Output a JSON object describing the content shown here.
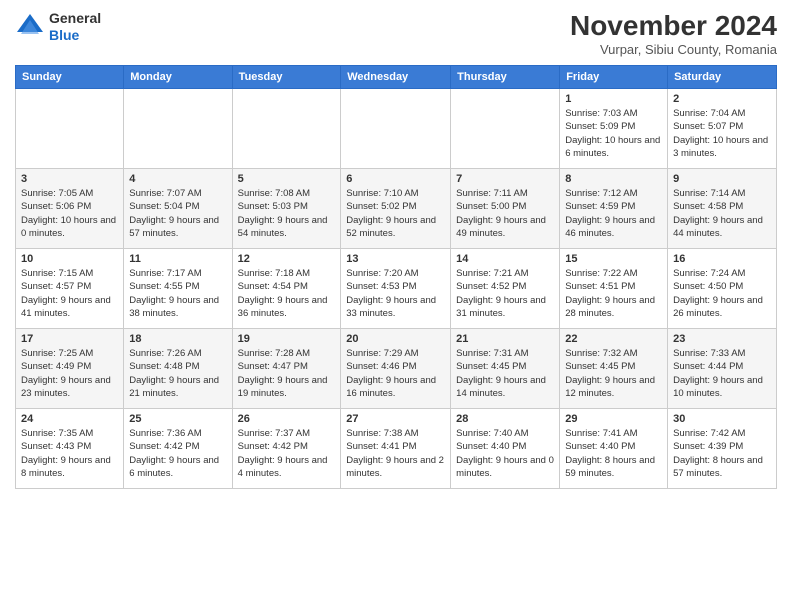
{
  "header": {
    "logo_line1": "General",
    "logo_line2": "Blue",
    "month_title": "November 2024",
    "location": "Vurpar, Sibiu County, Romania"
  },
  "days_of_week": [
    "Sunday",
    "Monday",
    "Tuesday",
    "Wednesday",
    "Thursday",
    "Friday",
    "Saturday"
  ],
  "weeks": [
    [
      {
        "day": "",
        "info": ""
      },
      {
        "day": "",
        "info": ""
      },
      {
        "day": "",
        "info": ""
      },
      {
        "day": "",
        "info": ""
      },
      {
        "day": "",
        "info": ""
      },
      {
        "day": "1",
        "info": "Sunrise: 7:03 AM\nSunset: 5:09 PM\nDaylight: 10 hours and 6 minutes."
      },
      {
        "day": "2",
        "info": "Sunrise: 7:04 AM\nSunset: 5:07 PM\nDaylight: 10 hours and 3 minutes."
      }
    ],
    [
      {
        "day": "3",
        "info": "Sunrise: 7:05 AM\nSunset: 5:06 PM\nDaylight: 10 hours and 0 minutes."
      },
      {
        "day": "4",
        "info": "Sunrise: 7:07 AM\nSunset: 5:04 PM\nDaylight: 9 hours and 57 minutes."
      },
      {
        "day": "5",
        "info": "Sunrise: 7:08 AM\nSunset: 5:03 PM\nDaylight: 9 hours and 54 minutes."
      },
      {
        "day": "6",
        "info": "Sunrise: 7:10 AM\nSunset: 5:02 PM\nDaylight: 9 hours and 52 minutes."
      },
      {
        "day": "7",
        "info": "Sunrise: 7:11 AM\nSunset: 5:00 PM\nDaylight: 9 hours and 49 minutes."
      },
      {
        "day": "8",
        "info": "Sunrise: 7:12 AM\nSunset: 4:59 PM\nDaylight: 9 hours and 46 minutes."
      },
      {
        "day": "9",
        "info": "Sunrise: 7:14 AM\nSunset: 4:58 PM\nDaylight: 9 hours and 44 minutes."
      }
    ],
    [
      {
        "day": "10",
        "info": "Sunrise: 7:15 AM\nSunset: 4:57 PM\nDaylight: 9 hours and 41 minutes."
      },
      {
        "day": "11",
        "info": "Sunrise: 7:17 AM\nSunset: 4:55 PM\nDaylight: 9 hours and 38 minutes."
      },
      {
        "day": "12",
        "info": "Sunrise: 7:18 AM\nSunset: 4:54 PM\nDaylight: 9 hours and 36 minutes."
      },
      {
        "day": "13",
        "info": "Sunrise: 7:20 AM\nSunset: 4:53 PM\nDaylight: 9 hours and 33 minutes."
      },
      {
        "day": "14",
        "info": "Sunrise: 7:21 AM\nSunset: 4:52 PM\nDaylight: 9 hours and 31 minutes."
      },
      {
        "day": "15",
        "info": "Sunrise: 7:22 AM\nSunset: 4:51 PM\nDaylight: 9 hours and 28 minutes."
      },
      {
        "day": "16",
        "info": "Sunrise: 7:24 AM\nSunset: 4:50 PM\nDaylight: 9 hours and 26 minutes."
      }
    ],
    [
      {
        "day": "17",
        "info": "Sunrise: 7:25 AM\nSunset: 4:49 PM\nDaylight: 9 hours and 23 minutes."
      },
      {
        "day": "18",
        "info": "Sunrise: 7:26 AM\nSunset: 4:48 PM\nDaylight: 9 hours and 21 minutes."
      },
      {
        "day": "19",
        "info": "Sunrise: 7:28 AM\nSunset: 4:47 PM\nDaylight: 9 hours and 19 minutes."
      },
      {
        "day": "20",
        "info": "Sunrise: 7:29 AM\nSunset: 4:46 PM\nDaylight: 9 hours and 16 minutes."
      },
      {
        "day": "21",
        "info": "Sunrise: 7:31 AM\nSunset: 4:45 PM\nDaylight: 9 hours and 14 minutes."
      },
      {
        "day": "22",
        "info": "Sunrise: 7:32 AM\nSunset: 4:45 PM\nDaylight: 9 hours and 12 minutes."
      },
      {
        "day": "23",
        "info": "Sunrise: 7:33 AM\nSunset: 4:44 PM\nDaylight: 9 hours and 10 minutes."
      }
    ],
    [
      {
        "day": "24",
        "info": "Sunrise: 7:35 AM\nSunset: 4:43 PM\nDaylight: 9 hours and 8 minutes."
      },
      {
        "day": "25",
        "info": "Sunrise: 7:36 AM\nSunset: 4:42 PM\nDaylight: 9 hours and 6 minutes."
      },
      {
        "day": "26",
        "info": "Sunrise: 7:37 AM\nSunset: 4:42 PM\nDaylight: 9 hours and 4 minutes."
      },
      {
        "day": "27",
        "info": "Sunrise: 7:38 AM\nSunset: 4:41 PM\nDaylight: 9 hours and 2 minutes."
      },
      {
        "day": "28",
        "info": "Sunrise: 7:40 AM\nSunset: 4:40 PM\nDaylight: 9 hours and 0 minutes."
      },
      {
        "day": "29",
        "info": "Sunrise: 7:41 AM\nSunset: 4:40 PM\nDaylight: 8 hours and 59 minutes."
      },
      {
        "day": "30",
        "info": "Sunrise: 7:42 AM\nSunset: 4:39 PM\nDaylight: 8 hours and 57 minutes."
      }
    ]
  ]
}
